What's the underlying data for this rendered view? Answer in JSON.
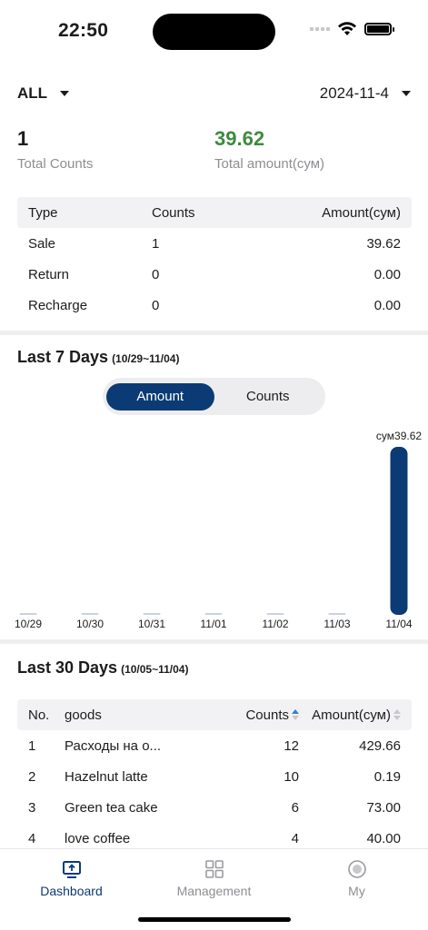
{
  "status": {
    "time": "22:50"
  },
  "filters": {
    "scope": "ALL",
    "date": "2024-11-4"
  },
  "totals": {
    "counts_value": "1",
    "counts_label": "Total Counts",
    "amount_value": "39.62",
    "amount_label": "Total amount(сум)"
  },
  "summary": {
    "headers": [
      "Type",
      "Counts",
      "Amount(сум)"
    ],
    "rows": [
      [
        "Sale",
        "1",
        "39.62"
      ],
      [
        "Return",
        "0",
        "0.00"
      ],
      [
        "Recharge",
        "0",
        "0.00"
      ]
    ]
  },
  "last7": {
    "title": "Last 7 Days",
    "range": "(10/29~11/04)",
    "toggle": [
      "Amount",
      "Counts"
    ],
    "active_toggle": "Amount"
  },
  "chart_data": {
    "type": "bar",
    "categories": [
      "10/29",
      "10/30",
      "10/31",
      "11/01",
      "11/02",
      "11/03",
      "11/04"
    ],
    "values": [
      0,
      0,
      0,
      0,
      0,
      0,
      39.62
    ],
    "data_labels": [
      "",
      "",
      "",
      "",
      "",
      "",
      "сум39.62"
    ],
    "color": "#0b3b74",
    "zero_color": "#c8d3e0"
  },
  "last30": {
    "title": "Last 30 Days",
    "range": "(10/05~11/04)",
    "headers": [
      "No.",
      "goods",
      "Counts",
      "Amount(сум)"
    ],
    "rows": [
      [
        "1",
        "Расходы на о...",
        "12",
        "429.66"
      ],
      [
        "2",
        "Hazelnut latte",
        "10",
        "0.19"
      ],
      [
        "3",
        "Green tea cake",
        "6",
        "73.00"
      ],
      [
        "4",
        "love coffee",
        "4",
        "40.00"
      ]
    ]
  },
  "tabs": [
    {
      "label": "Dashboard",
      "icon": "dashboard-icon",
      "active": true
    },
    {
      "label": "Management",
      "icon": "grid-icon",
      "active": false
    },
    {
      "label": "My",
      "icon": "user-icon",
      "active": false
    }
  ],
  "colors": {
    "accent": "#0b3b74",
    "positive": "#3d8b3d"
  }
}
